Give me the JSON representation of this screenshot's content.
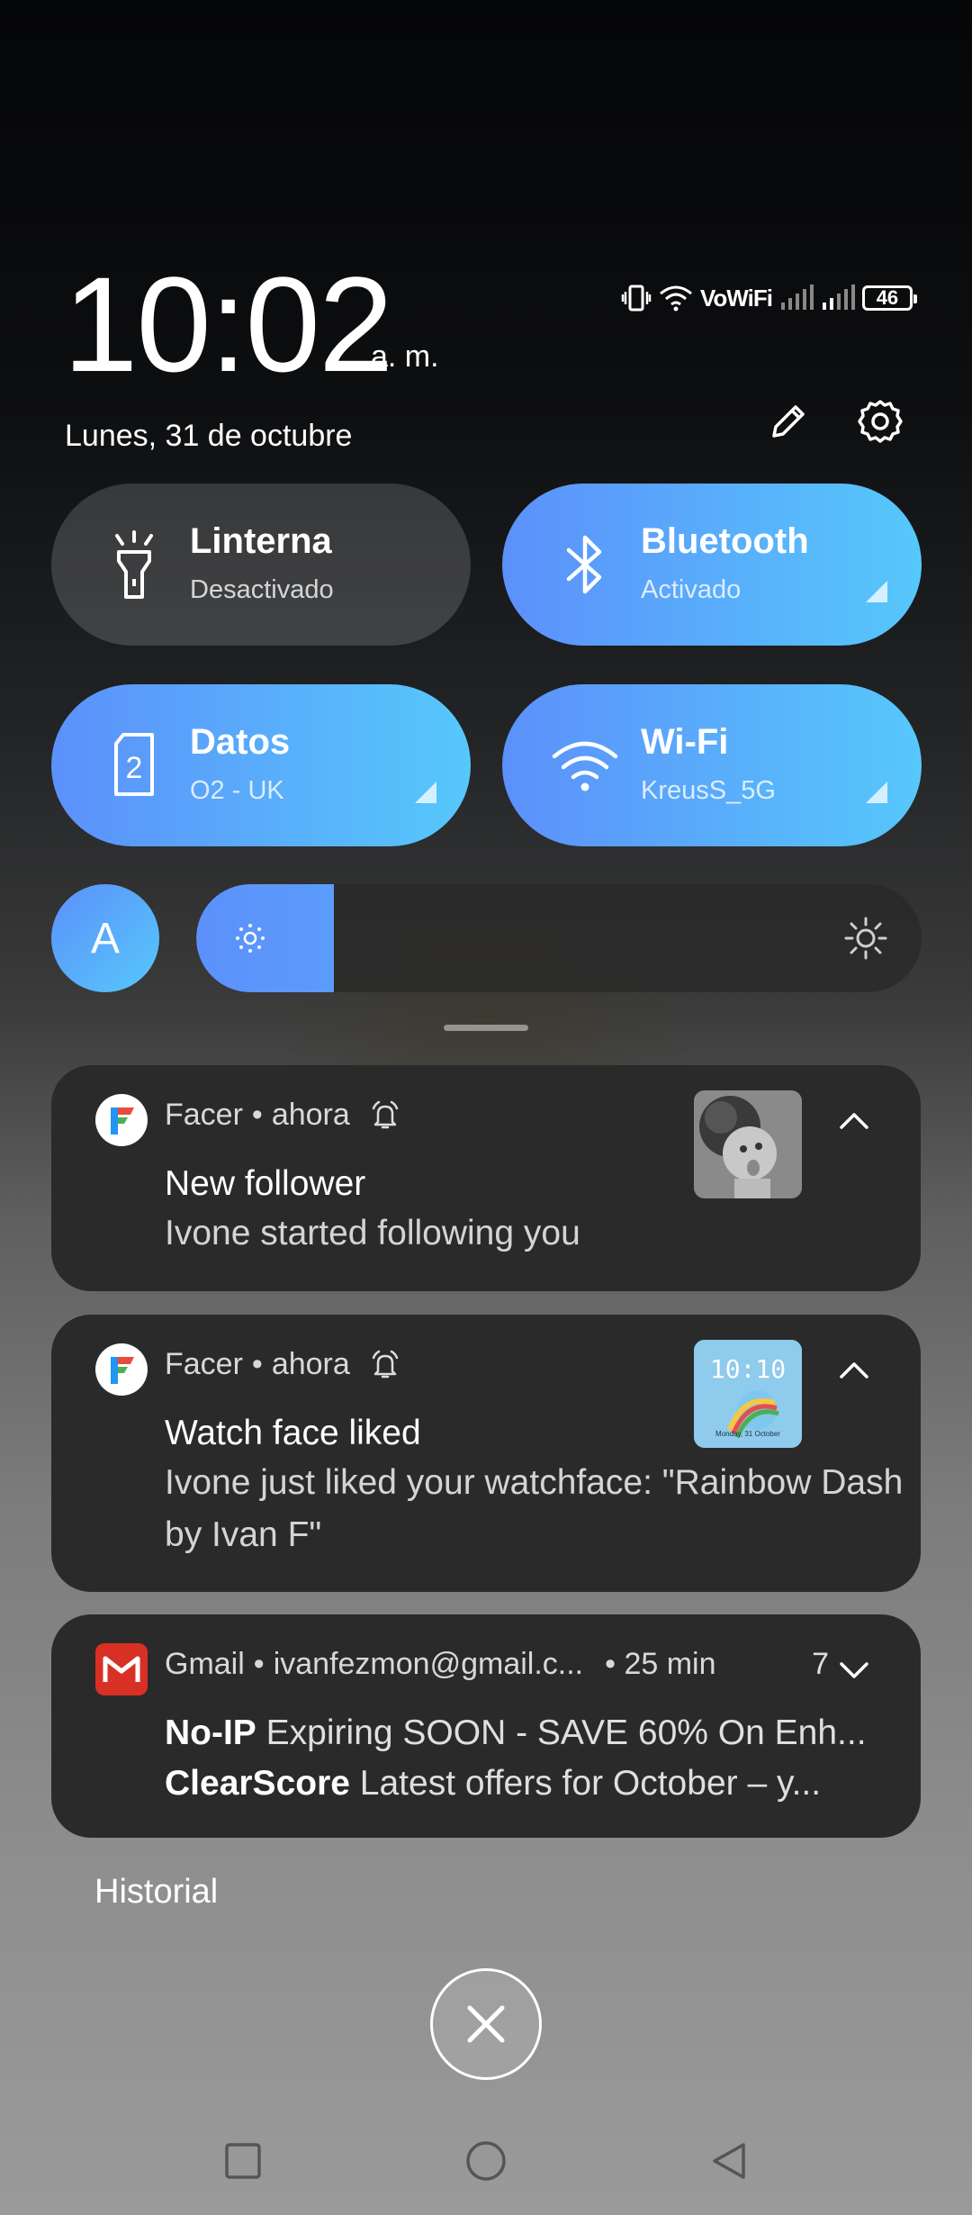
{
  "header": {
    "time": "10:02",
    "ampm": "a. m.",
    "date": "Lunes, 31 de octubre",
    "status": {
      "network_label": "VoWiFi",
      "battery": "46"
    }
  },
  "tiles": [
    {
      "title": "Linterna",
      "subtitle": "Desactivado",
      "icon": "flashlight-icon",
      "state": "off"
    },
    {
      "title": "Bluetooth",
      "subtitle": "Activado",
      "icon": "bluetooth-icon",
      "state": "on"
    },
    {
      "title": "Datos",
      "subtitle": "O2 - UK",
      "icon": "sim-2-icon",
      "state": "on"
    },
    {
      "title": "Wi-Fi",
      "subtitle": "KreusS_5G",
      "icon": "wifi-icon",
      "state": "on"
    }
  ],
  "brightness": {
    "auto_label": "A",
    "level": 0.19
  },
  "notifications": [
    {
      "app": "Facer",
      "sep": "•",
      "time": "ahora",
      "title": "New follower",
      "text": "Ivone started following you"
    },
    {
      "app": "Facer",
      "sep": "•",
      "time": "ahora",
      "title": "Watch face liked",
      "text": "Ivone just liked your watchface: \"Rainbow Dash by Ivan F\"",
      "thumb_time": "10:10",
      "thumb_date": "Monday, 31 October"
    },
    {
      "app": "Gmail",
      "sep": "•",
      "account": "ivanfezmon@gmail.c...",
      "time": "• 25 min",
      "count": "7",
      "lines": [
        {
          "sender": "No-IP",
          "subject": "Expiring SOON - SAVE 60% On Enh..."
        },
        {
          "sender": "ClearScore",
          "subject": "Latest offers for October – y..."
        }
      ]
    }
  ],
  "history_label": "Historial",
  "colors": {
    "tile_on_start": "#5c90fb",
    "tile_on_end": "#56c8fb",
    "card_bg": "#2a2a2b"
  }
}
